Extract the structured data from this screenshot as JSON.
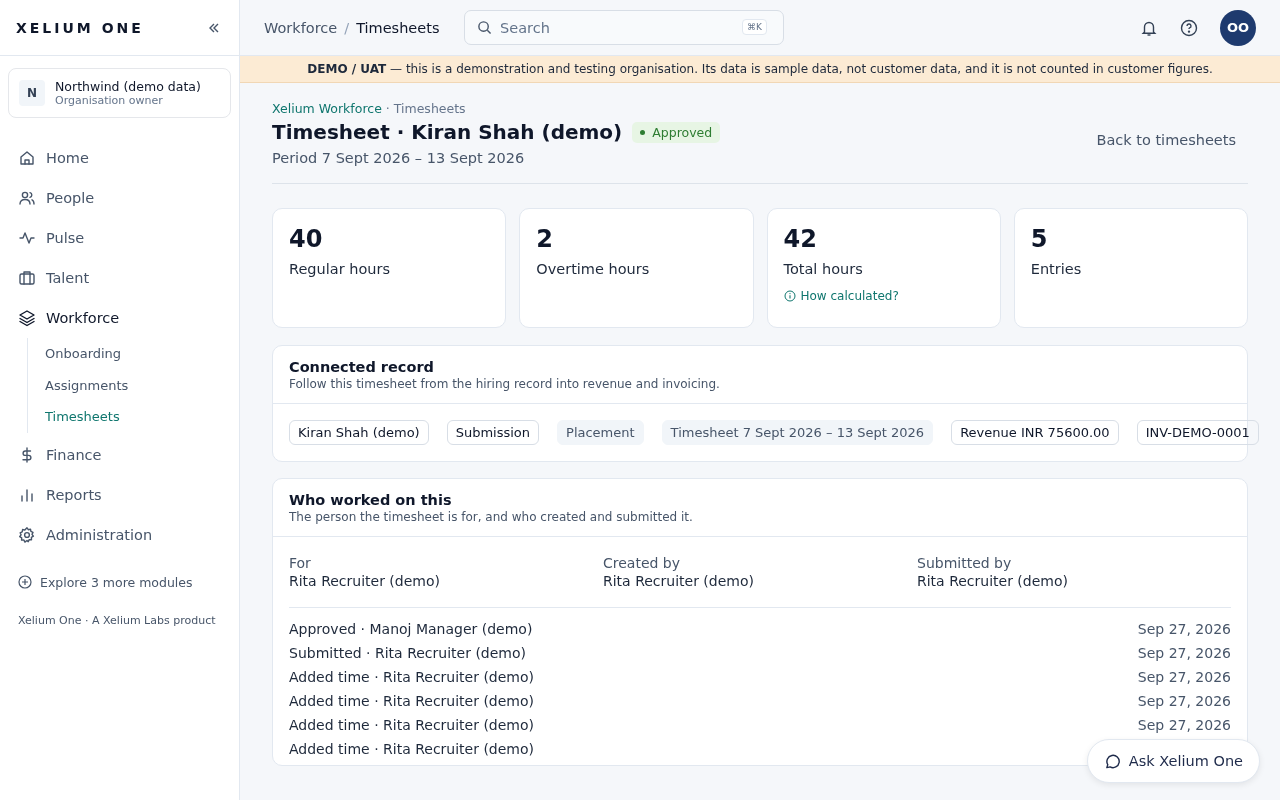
{
  "brand": "XELIUM ONE",
  "org": {
    "initial": "N",
    "name": "Northwind (demo data)",
    "role": "Organisation owner"
  },
  "nav": [
    {
      "label": "Home",
      "kind": "home",
      "selected": false
    },
    {
      "label": "People",
      "kind": "people",
      "selected": false
    },
    {
      "label": "Pulse",
      "kind": "pulse",
      "selected": false
    },
    {
      "label": "Talent",
      "kind": "briefcase",
      "selected": false
    },
    {
      "label": "Workforce",
      "kind": "layers",
      "selected": true,
      "children": [
        {
          "label": "Onboarding",
          "selected": false
        },
        {
          "label": "Assignments",
          "selected": false
        },
        {
          "label": "Timesheets",
          "selected": true
        }
      ]
    },
    {
      "label": "Finance",
      "kind": "dollar",
      "selected": false
    },
    {
      "label": "Reports",
      "kind": "bars",
      "selected": false
    },
    {
      "label": "Administration",
      "kind": "gear",
      "selected": false
    }
  ],
  "explore": "Explore 3 more modules",
  "footer": "Xelium One · A Xelium Labs product",
  "breadcrumb": [
    "Workforce",
    "Timesheets"
  ],
  "breadcrumb_separator": "/",
  "search": {
    "placeholder": "Search",
    "shortcut": "⌘K"
  },
  "avatar": "OO",
  "banner": {
    "label": "DEMO / UAT",
    "text": "— this is a demonstration and testing organisation. Its data is sample data, not customer data, and it is not counted in customer figures."
  },
  "crumbs": {
    "link": "Xelium Workforce",
    "rest": "· Timesheets"
  },
  "title": "Timesheet · Kiran Shah (demo)",
  "status": {
    "label": "Approved",
    "color": "#2e7d32"
  },
  "period": "Period 7 Sept 2026 – 13 Sept 2026",
  "back": "Back to timesheets",
  "stats": [
    {
      "value": "40",
      "label": "Regular hours"
    },
    {
      "value": "2",
      "label": "Overtime hours"
    },
    {
      "value": "42",
      "label": "Total hours",
      "link": "How calculated?"
    },
    {
      "value": "5",
      "label": "Entries"
    }
  ],
  "connected": {
    "title": "Connected record",
    "subtitle": "Follow this timesheet from the hiring record into revenue and invoicing.",
    "chips": [
      {
        "label": "Kiran Shah (demo)",
        "muted": false
      },
      {
        "label": "Submission",
        "muted": false
      },
      {
        "label": "Placement",
        "muted": true
      },
      {
        "label": "Timesheet 7 Sept 2026 – 13 Sept 2026",
        "muted": true
      },
      {
        "label": "Revenue INR 75600.00",
        "muted": false
      },
      {
        "label": "INV-DEMO-0001",
        "muted": false
      }
    ]
  },
  "who": {
    "title": "Who worked on this",
    "subtitle": "The person the timesheet is for, and who created and submitted it.",
    "fields": [
      {
        "label": "For",
        "value": "Rita Recruiter (demo)"
      },
      {
        "label": "Created by",
        "value": "Rita Recruiter (demo)"
      },
      {
        "label": "Submitted by",
        "value": "Rita Recruiter (demo)"
      }
    ],
    "activity": [
      {
        "text": "Approved · Manoj Manager (demo)",
        "date": "Sep 27, 2026"
      },
      {
        "text": "Submitted · Rita Recruiter (demo)",
        "date": "Sep 27, 2026"
      },
      {
        "text": "Added time · Rita Recruiter (demo)",
        "date": "Sep 27, 2026"
      },
      {
        "text": "Added time · Rita Recruiter (demo)",
        "date": "Sep 27, 2026"
      },
      {
        "text": "Added time · Rita Recruiter (demo)",
        "date": "Sep 27, 2026"
      },
      {
        "text": "Added time · Rita Recruiter (demo)"
      }
    ]
  },
  "ask": "Ask Xelium One"
}
